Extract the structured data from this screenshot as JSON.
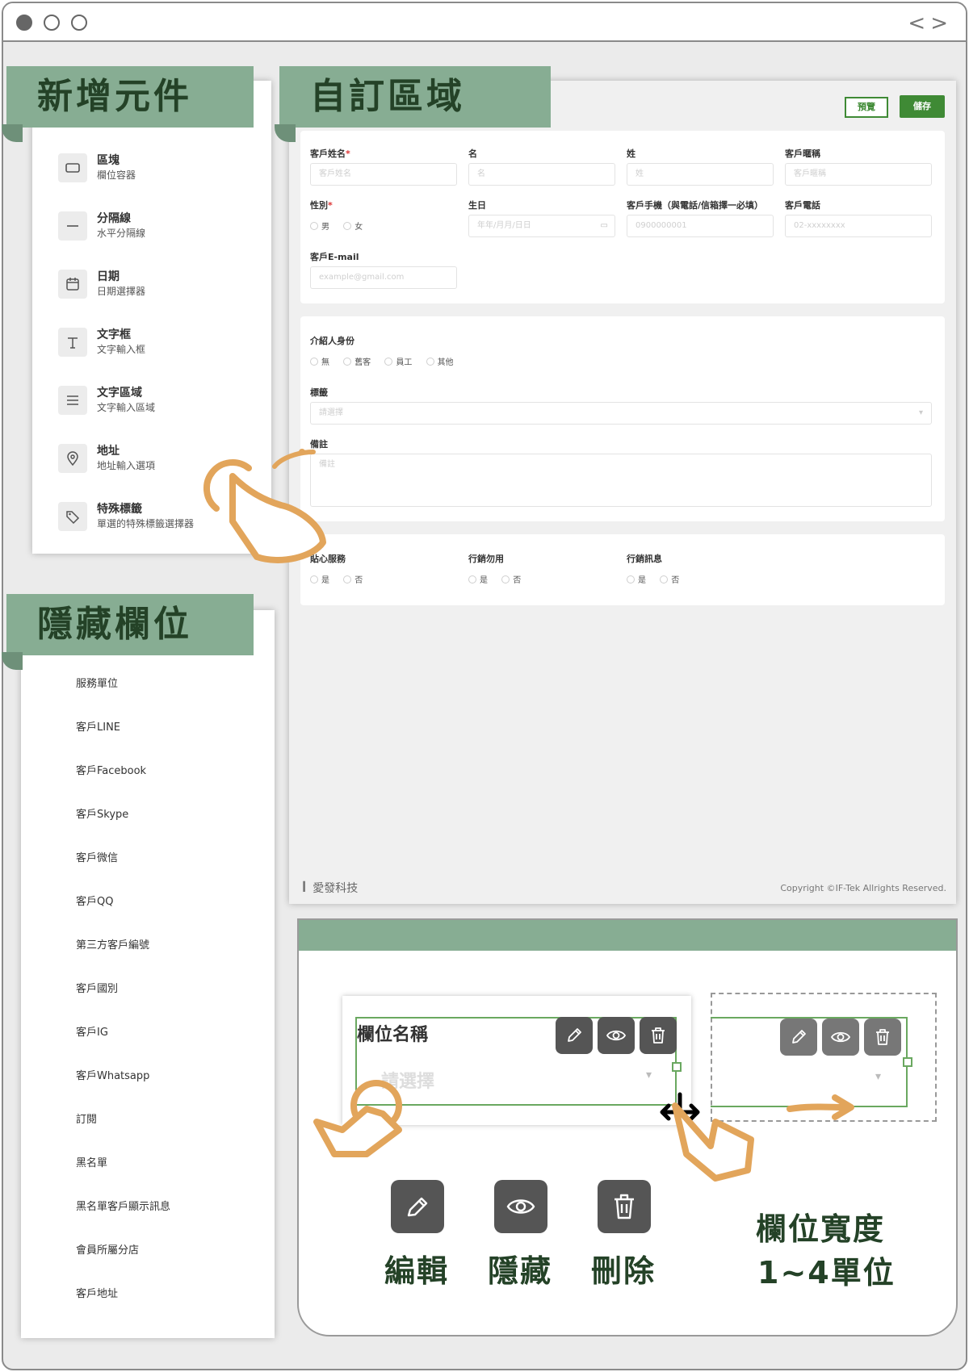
{
  "add_components": {
    "title": "新增元件",
    "items": [
      {
        "title": "區塊",
        "subtitle": "欄位容器",
        "icon": "rectangle-icon"
      },
      {
        "title": "分隔線",
        "subtitle": "水平分隔線",
        "icon": "minus-icon"
      },
      {
        "title": "日期",
        "subtitle": "日期選擇器",
        "icon": "calendar-icon"
      },
      {
        "title": "文字框",
        "subtitle": "文字輸入框",
        "icon": "text-icon"
      },
      {
        "title": "文字區域",
        "subtitle": "文字輸入區域",
        "icon": "lines-icon"
      },
      {
        "title": "地址",
        "subtitle": "地址輸入選項",
        "icon": "map-pin-icon"
      },
      {
        "title": "特殊標籤",
        "subtitle": "單選的特殊標籤選擇器",
        "icon": "tag-icon"
      }
    ]
  },
  "hidden_fields": {
    "title": "隱藏欄位",
    "items": [
      "服務單位",
      "客戶LINE",
      "客戶Facebook",
      "客戶Skype",
      "客戶微信",
      "客戶QQ",
      "第三方客戶編號",
      "客戶國別",
      "客戶IG",
      "客戶Whatsapp",
      "訂閱",
      "黑名單",
      "黑名單客戶顯示訊息",
      "會員所屬分店",
      "客戶地址"
    ]
  },
  "custom_area": {
    "title": "自訂區域",
    "preview_label": "預覽",
    "save_label": "儲存",
    "card1": {
      "name_label": "客戶姓名",
      "name_placeholder": "客戶姓名",
      "first_label": "名",
      "first_placeholder": "名",
      "last_label": "姓",
      "last_placeholder": "姓",
      "nick_label": "客戶暱稱",
      "nick_placeholder": "客戶暱稱",
      "gender_label": "性別",
      "gender_male": "男",
      "gender_female": "女",
      "birthday_label": "生日",
      "birthday_placeholder": "年年/月月/日日",
      "mobile_label": "客戶手機（與電話/信箱擇一必填）",
      "mobile_placeholder": "0900000001",
      "phone_label": "客戶電話",
      "phone_placeholder": "02-xxxxxxxx",
      "email_label": "客戶E-mail",
      "email_placeholder": "example@gmail.com",
      "required_mark": "*"
    },
    "card2": {
      "referrer_label": "介紹人身份",
      "referrer_options": [
        "無",
        "舊客",
        "員工",
        "其他"
      ],
      "tag_label": "標籤",
      "tag_placeholder": "請選擇",
      "note_label": "備註",
      "note_placeholder": "備註"
    },
    "card3": {
      "care_label": "貼心服務",
      "no_marketing_label": "行銷勿用",
      "marketing_msg_label": "行銷訊息",
      "yes": "是",
      "no": "否"
    },
    "footer_brand": "愛發科技",
    "footer_copyright": "Copyright ©IF-Tek Allrights Reserved."
  },
  "tutorial": {
    "field_name": "欄位名稱",
    "select_placeholder": "請選擇",
    "edit_label": "編輯",
    "hide_label": "隱藏",
    "delete_label": "刪除",
    "width_label_1": "欄位寬度",
    "width_label_2": "1~4單位"
  },
  "colors": {
    "banner": "#87ad93",
    "banner_text": "#244227",
    "accent_green": "#3f8a35",
    "hand_orange": "#e2a55b"
  }
}
